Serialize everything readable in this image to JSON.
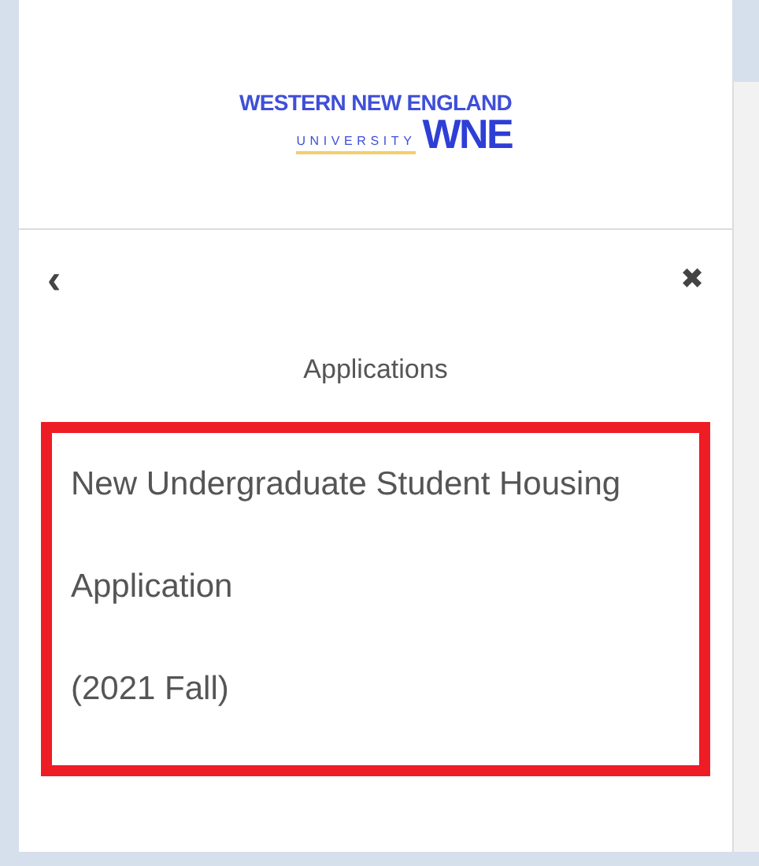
{
  "logo": {
    "line_1": "WESTERN NEW ENGLAND",
    "line_2": "UNIVERSITY",
    "mark": "WNE"
  },
  "nav": {
    "back": "‹",
    "close": "✖"
  },
  "section_title": "Applications",
  "applications": [
    {
      "lines": [
        "New Undergraduate Student Housing",
        "Application",
        "(2021 Fall)"
      ],
      "highlighted": true
    }
  ]
}
